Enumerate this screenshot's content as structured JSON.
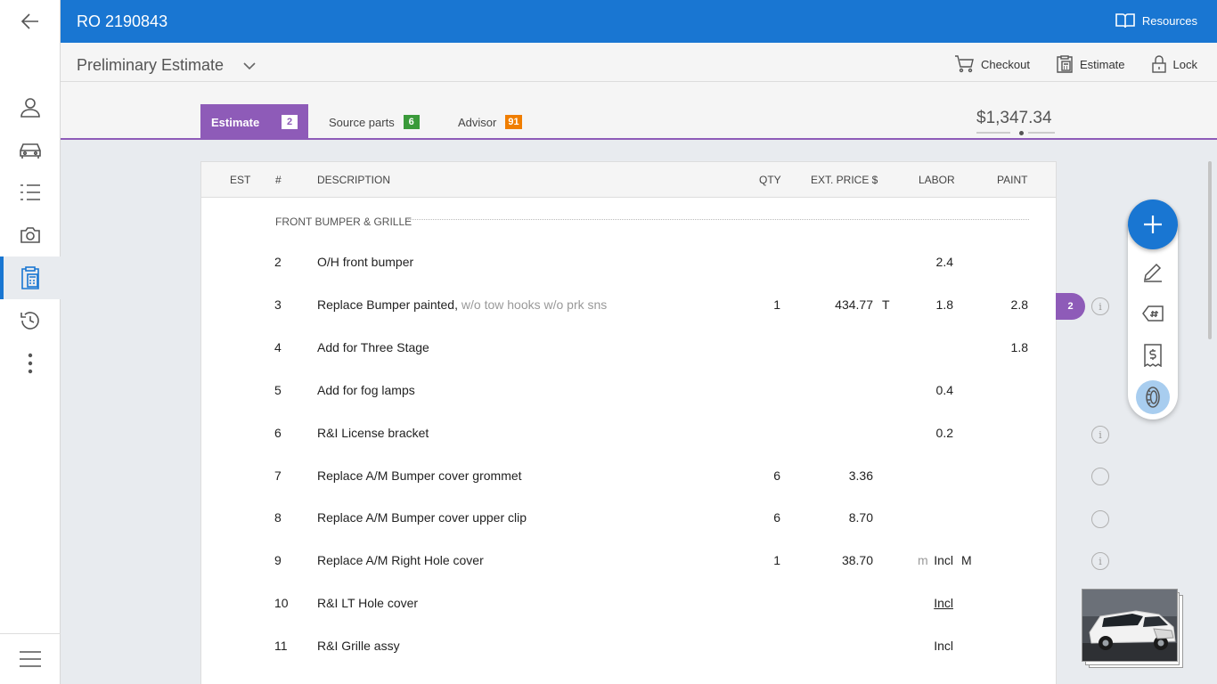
{
  "header": {
    "title": "RO 2190843",
    "resources_label": "Resources"
  },
  "subheader": {
    "estimate_title": "Preliminary Estimate",
    "actions": {
      "checkout": "Checkout",
      "estimate": "Estimate",
      "lock": "Lock"
    }
  },
  "tabs": [
    {
      "label": "Estimate",
      "badge": "2"
    },
    {
      "label": "Source parts",
      "badge": "6"
    },
    {
      "label": "Advisor",
      "badge": "91"
    }
  ],
  "total": "$1,347.34",
  "table": {
    "headers": {
      "est": "EST",
      "num": "#",
      "description": "DESCRIPTION",
      "qty": "QTY",
      "ext_price": "EXT. PRICE $",
      "labor": "LABOR",
      "paint": "PAINT"
    },
    "section": "FRONT BUMPER & GRILLE",
    "rows": [
      {
        "num": "2",
        "desc": "O/H front bumper",
        "desc_extra": "",
        "qty": "",
        "ext": "",
        "ext_flag": "",
        "labor_mark": "",
        "labor": "2.4",
        "labor_flag": "",
        "paint": ""
      },
      {
        "num": "3",
        "desc": "Replace Bumper painted,",
        "desc_extra": " w/o tow hooks w/o prk sns",
        "qty": "1",
        "ext": "434.77",
        "ext_flag": "T",
        "labor_mark": "",
        "labor": "1.8",
        "labor_flag": "",
        "paint": "2.8"
      },
      {
        "num": "4",
        "desc": "Add for Three Stage",
        "desc_extra": "",
        "qty": "",
        "ext": "",
        "ext_flag": "",
        "labor_mark": "",
        "labor": "",
        "labor_flag": "",
        "paint": "1.8"
      },
      {
        "num": "5",
        "desc": "Add for fog lamps",
        "desc_extra": "",
        "qty": "",
        "ext": "",
        "ext_flag": "",
        "labor_mark": "",
        "labor": "0.4",
        "labor_flag": "",
        "paint": ""
      },
      {
        "num": "6",
        "desc": "R&I License bracket",
        "desc_extra": "",
        "qty": "",
        "ext": "",
        "ext_flag": "",
        "labor_mark": "",
        "labor": "0.2",
        "labor_flag": "",
        "paint": ""
      },
      {
        "num": "7",
        "desc": "Replace A/M Bumper cover grommet",
        "desc_extra": "",
        "qty": "6",
        "ext": "3.36",
        "ext_flag": "",
        "labor_mark": "",
        "labor": "",
        "labor_flag": "",
        "paint": ""
      },
      {
        "num": "8",
        "desc": "Replace A/M Bumper cover upper clip",
        "desc_extra": "",
        "qty": "6",
        "ext": "8.70",
        "ext_flag": "",
        "labor_mark": "",
        "labor": "",
        "labor_flag": "",
        "paint": ""
      },
      {
        "num": "9",
        "desc": "Replace A/M Right Hole cover",
        "desc_extra": "",
        "qty": "1",
        "ext": "38.70",
        "ext_flag": "",
        "labor_mark": "m",
        "labor": "Incl",
        "labor_flag": "M",
        "paint": ""
      },
      {
        "num": "10",
        "desc": "R&I LT Hole cover",
        "desc_extra": "",
        "qty": "",
        "ext": "",
        "ext_flag": "",
        "labor_mark": "",
        "labor": "Incl",
        "labor_flag": "",
        "paint": ""
      },
      {
        "num": "11",
        "desc": "R&I Grille assy",
        "desc_extra": "",
        "qty": "",
        "ext": "",
        "ext_flag": "",
        "labor_mark": "",
        "labor": "Incl",
        "labor_flag": "",
        "paint": ""
      }
    ]
  },
  "row_badge": "2",
  "colors": {
    "primary_blue": "#1976d2",
    "estimate_purple": "#8e5bb8",
    "source_green": "#3a9a3a",
    "advisor_orange": "#f07e00"
  },
  "icons": {
    "sidebar": [
      "back-arrow-icon",
      "user-icon",
      "car-icon",
      "list-icon",
      "camera-icon",
      "clipboard-calculator-icon",
      "history-icon",
      "more-vertical-icon",
      "menu-icon"
    ],
    "fab_tools": [
      "add-icon",
      "pencil-icon",
      "tag-hash-icon",
      "receipt-dollar-icon",
      "tire-icon"
    ]
  }
}
